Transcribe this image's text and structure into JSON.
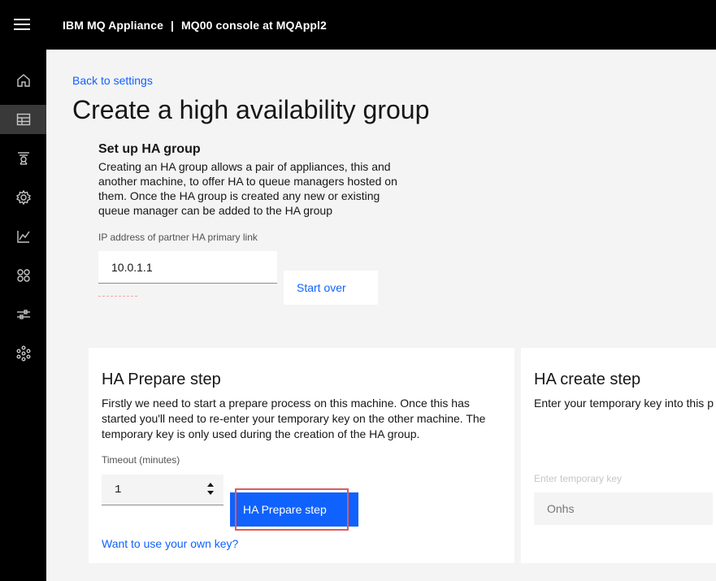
{
  "header": {
    "product": "IBM MQ Appliance",
    "separator": "|",
    "context": "MQ00 console at MQAppl2"
  },
  "sidenav": {
    "items": [
      {
        "icon": "home-icon",
        "active": false
      },
      {
        "icon": "table-icon",
        "active": true
      },
      {
        "icon": "queue-icon",
        "active": false
      },
      {
        "icon": "gear-icon",
        "active": false
      },
      {
        "icon": "chart-icon",
        "active": false
      },
      {
        "icon": "apps-icon",
        "active": false
      },
      {
        "icon": "sliders-icon",
        "active": false
      },
      {
        "icon": "network-icon",
        "active": false
      }
    ]
  },
  "page": {
    "back_link": "Back to settings",
    "title": "Create a high availability group"
  },
  "setup": {
    "heading": "Set up HA group",
    "description": "Creating an HA group allows a pair of appliances, this and another machine, to offer HA to queue managers hosted on them. Once the HA group is created any new or existing queue manager can be added to the HA group",
    "ip_label": "IP address of partner HA primary link",
    "ip_value": "10.0.1.1",
    "start_over": "Start over"
  },
  "prepare": {
    "title": "HA Prepare step",
    "description": "Firstly we need to start a prepare process on this machine. Once this has started you'll need to re-enter your temporary key on the other machine. The temporary key is only used during the creation of the HA group.",
    "timeout_label": "Timeout (minutes)",
    "timeout_value": "1",
    "button": "HA Prepare step",
    "own_key_link": "Want to use your own key?"
  },
  "create": {
    "title": "HA create step",
    "description": "Enter your temporary key into this p",
    "key_label": "Enter temporary key",
    "key_placeholder": "Onhs"
  },
  "colors": {
    "accent": "#0f62fe",
    "highlight": "#e05a5a",
    "topbar": "#000000"
  }
}
